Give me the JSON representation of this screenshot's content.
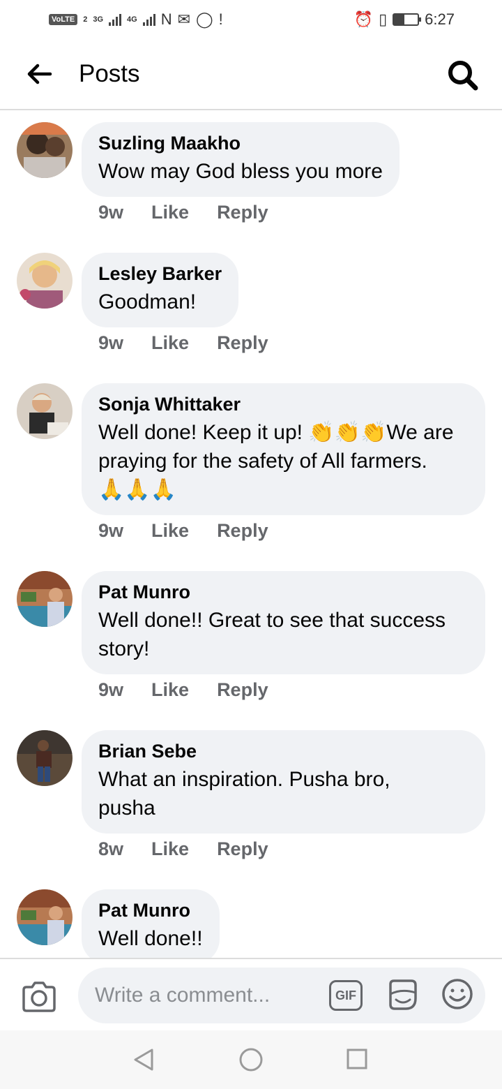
{
  "status_bar": {
    "volte": "VoLTE",
    "sim": "2",
    "net1": "3G",
    "net2": "4G",
    "time": "6:27"
  },
  "header": {
    "title": "Posts"
  },
  "comments": [
    {
      "author": "Suzling Maakho",
      "text": "Wow may God bless you more",
      "time": "9w",
      "like": "Like",
      "reply": "Reply"
    },
    {
      "author": "Lesley Barker",
      "text": "Goodman!",
      "time": "9w",
      "like": "Like",
      "reply": "Reply"
    },
    {
      "author": "Sonja Whittaker",
      "text_line1": "Well done! Keep it up! ",
      "emoji_claps": "👏👏👏",
      "text_line1b": "We are",
      "text_line2": "praying for the safety of All farmers.",
      "emoji_pray": "🙏🙏🙏",
      "time": "9w",
      "like": "Like",
      "reply": "Reply"
    },
    {
      "author": "Pat Munro",
      "text_line1": "Well done!! Great to see that success",
      "text_line2": "story!",
      "time": "9w",
      "like": "Like",
      "reply": "Reply"
    },
    {
      "author": "Brian Sebe",
      "text_line1": "What an inspiration. Pusha bro,",
      "text_line2": "pusha",
      "time": "8w",
      "like": "Like",
      "reply": "Reply"
    },
    {
      "author": "Pat Munro",
      "text": "Well done!!"
    }
  ],
  "composer": {
    "placeholder": "Write a comment...",
    "gif_label": "GIF"
  },
  "colors": {
    "bubble": "#f0f2f5",
    "secondary_text": "#65676b",
    "divider": "#dcdcdc"
  },
  "icons": [
    "back-arrow-icon",
    "search-icon",
    "camera-icon",
    "gif-icon",
    "sticker-icon",
    "emoji-icon",
    "nav-back-icon",
    "nav-home-icon",
    "nav-recent-icon"
  ]
}
